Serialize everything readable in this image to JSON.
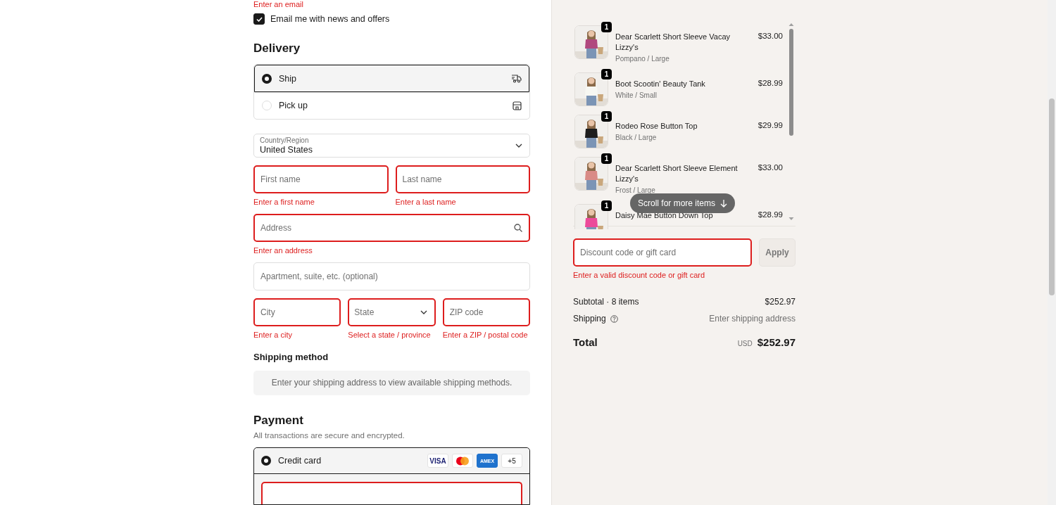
{
  "contact": {
    "error": "Enter an email",
    "newsletter": {
      "label": "Email me with news and offers",
      "checked": true
    }
  },
  "delivery": {
    "title": "Delivery",
    "options": [
      {
        "label": "Ship",
        "selected": true
      },
      {
        "label": "Pick up",
        "selected": false
      }
    ],
    "country": {
      "label": "Country/Region",
      "value": "United States"
    },
    "field_rows": [
      [
        {
          "kind": "text",
          "placeholder": "First name",
          "error": "Enter a first name"
        },
        {
          "kind": "text",
          "placeholder": "Last name",
          "error": "Enter a last name"
        }
      ],
      [
        {
          "kind": "search",
          "placeholder": "Address",
          "error": "Enter an address"
        }
      ],
      [
        {
          "kind": "text",
          "placeholder": "Apartment, suite, etc. (optional)"
        }
      ],
      [
        {
          "kind": "text",
          "placeholder": "City",
          "error": "Enter a city"
        },
        {
          "kind": "select",
          "placeholder": "State",
          "error": "Select a state / province"
        },
        {
          "kind": "text",
          "placeholder": "ZIP code",
          "error": "Enter a ZIP / postal code"
        }
      ]
    ]
  },
  "shipping_method": {
    "title": "Shipping method",
    "message": "Enter your shipping address to view available shipping methods."
  },
  "payment": {
    "title": "Payment",
    "subtitle": "All transactions are secure and encrypted.",
    "methods": [
      {
        "label": "Credit card",
        "selected": true,
        "badges": [
          {
            "kind": "visa",
            "text": "VISA"
          },
          {
            "kind": "mastercard"
          },
          {
            "kind": "amex",
            "text": "AMEX"
          },
          {
            "kind": "more",
            "text": "+5"
          }
        ]
      }
    ]
  },
  "summary": {
    "items": [
      {
        "title": "Dear Scarlett Short Sleeve Vacay Lizzy's",
        "variant": "Pompano / Large",
        "price": "$33.00",
        "quantity": "1"
      },
      {
        "title": "Boot Scootin' Beauty Tank",
        "variant": "White / Small",
        "price": "$28.99",
        "quantity": "1"
      },
      {
        "title": "Rodeo Rose Button Top",
        "variant": "Black / Large",
        "price": "$29.99",
        "quantity": "1"
      },
      {
        "title": "Dear Scarlett Short Sleeve Element Lizzy's",
        "variant": "Frost / Large",
        "price": "$33.00",
        "quantity": "1"
      },
      {
        "title": "Daisy Mae Button Down Top",
        "price": "$28.99",
        "quantity": "1"
      }
    ],
    "scroll_hint": "Scroll for more items",
    "discount": {
      "placeholder": "Discount code or gift card",
      "error": "Enter a valid discount code or gift card",
      "button": "Apply",
      "disabled": true
    },
    "subtotal": {
      "label": "Subtotal · 8 items",
      "value": "$252.97"
    },
    "shipping": {
      "label": "Shipping",
      "value": "Enter shipping address"
    },
    "total": {
      "label": "Total",
      "currency": "USD",
      "value": "$252.97"
    }
  }
}
